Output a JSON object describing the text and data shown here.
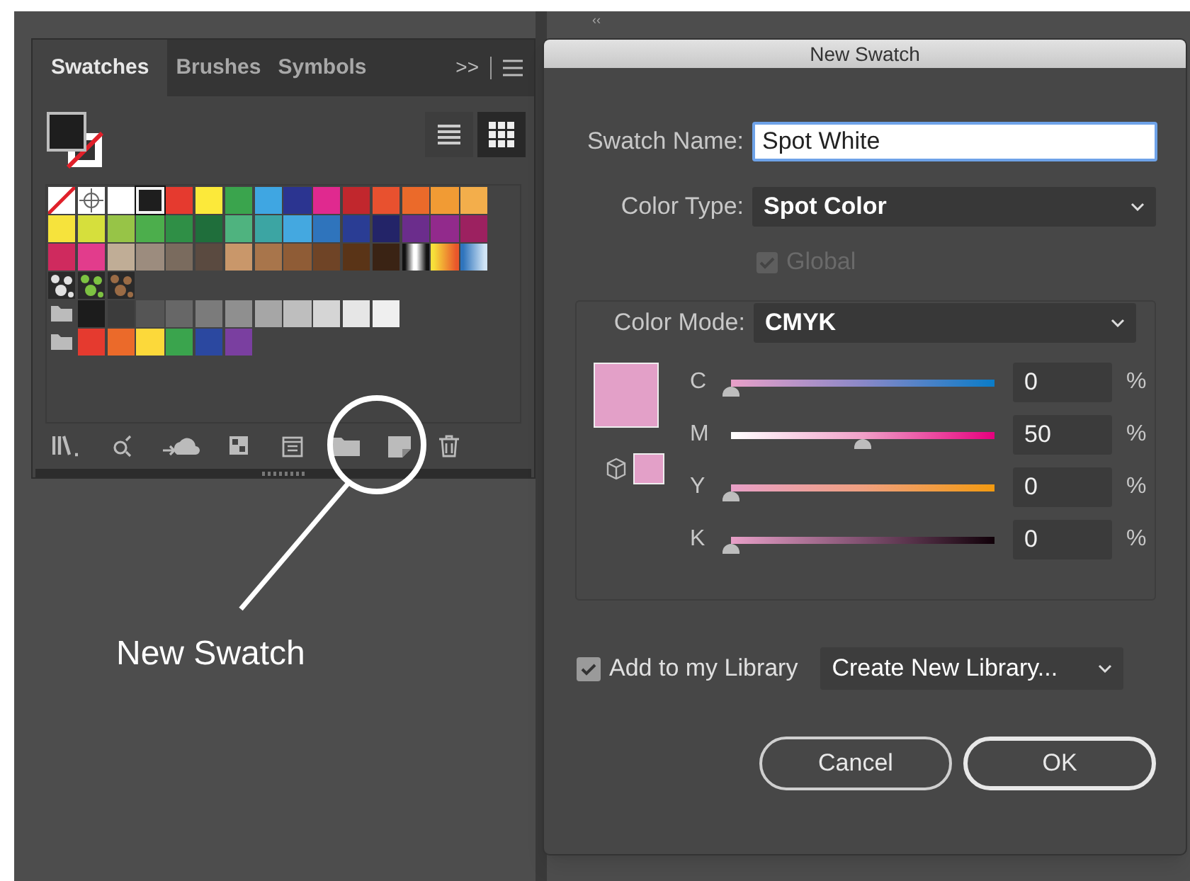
{
  "swatches_panel": {
    "tabs": [
      {
        "label": "Swatches",
        "selected": true
      },
      {
        "label": "Brushes",
        "selected": false
      },
      {
        "label": "Symbols",
        "selected": false
      }
    ],
    "overflow": ">>",
    "views": [
      {
        "kind": "list",
        "selected": false
      },
      {
        "kind": "grid",
        "selected": true
      }
    ],
    "rows": [
      {
        "items": [
          {
            "kind": "none",
            "selected": false
          },
          {
            "kind": "registration",
            "selected": false
          },
          {
            "kind": "color",
            "color": "#ffffff",
            "selected": false
          },
          {
            "kind": "color",
            "color": "#1e1e1e",
            "selected": true
          },
          {
            "kind": "color",
            "color": "#e53a2f",
            "selected": false
          },
          {
            "kind": "color",
            "color": "#fce93a",
            "selected": false
          },
          {
            "kind": "color",
            "color": "#3aa44d",
            "selected": false
          },
          {
            "kind": "color",
            "color": "#3fa6e2",
            "selected": false
          },
          {
            "kind": "color",
            "color": "#2b3490",
            "selected": false
          },
          {
            "kind": "color",
            "color": "#e0298f",
            "selected": false
          },
          {
            "kind": "color",
            "color": "#c1272d",
            "selected": false
          },
          {
            "kind": "color",
            "color": "#e8512f",
            "selected": false
          },
          {
            "kind": "color",
            "color": "#eb6a2a",
            "selected": false
          },
          {
            "kind": "color",
            "color": "#f19b34",
            "selected": false
          },
          {
            "kind": "color",
            "color": "#f3ae4b",
            "selected": false
          }
        ]
      },
      {
        "items": [
          {
            "kind": "color",
            "color": "#f6e33c",
            "selected": false
          },
          {
            "kind": "color",
            "color": "#d6df3c",
            "selected": false
          },
          {
            "kind": "color",
            "color": "#97c447",
            "selected": false
          },
          {
            "kind": "color",
            "color": "#4cae4c",
            "selected": false
          },
          {
            "kind": "color",
            "color": "#2f8f46",
            "selected": false
          },
          {
            "kind": "color",
            "color": "#1f6e3b",
            "selected": false
          },
          {
            "kind": "color",
            "color": "#4fb37f",
            "selected": false
          },
          {
            "kind": "color",
            "color": "#3ca5a3",
            "selected": false
          },
          {
            "kind": "color",
            "color": "#44a8e0",
            "selected": false
          },
          {
            "kind": "color",
            "color": "#2f74bc",
            "selected": false
          },
          {
            "kind": "color",
            "color": "#2a3d94",
            "selected": false
          },
          {
            "kind": "color",
            "color": "#232468",
            "selected": false
          },
          {
            "kind": "color",
            "color": "#6b2d8c",
            "selected": false
          },
          {
            "kind": "color",
            "color": "#922a8c",
            "selected": false
          },
          {
            "kind": "color",
            "color": "#9c2160",
            "selected": false
          }
        ]
      },
      {
        "items": [
          {
            "kind": "color",
            "color": "#cf2a5e",
            "selected": false
          },
          {
            "kind": "color",
            "color": "#e23c8c",
            "selected": false
          },
          {
            "kind": "color",
            "color": "#c0ad96",
            "selected": false
          },
          {
            "kind": "color",
            "color": "#9c8c7e",
            "selected": false
          },
          {
            "kind": "color",
            "color": "#7a6b5e",
            "selected": false
          },
          {
            "kind": "color",
            "color": "#5a4a40",
            "selected": false
          },
          {
            "kind": "color",
            "color": "#c9976a",
            "selected": false
          },
          {
            "kind": "color",
            "color": "#a8754b",
            "selected": false
          },
          {
            "kind": "color",
            "color": "#8f5c36",
            "selected": false
          },
          {
            "kind": "color",
            "color": "#6f4426",
            "selected": false
          },
          {
            "kind": "color",
            "color": "#5a3417",
            "selected": false
          },
          {
            "kind": "color",
            "color": "#3a2314",
            "selected": false
          },
          {
            "kind": "gradient",
            "stops": [
              {
                "color": "#111111"
              },
              {
                "color": "#ffffff"
              },
              {
                "color": "#111111"
              }
            ],
            "selected": false
          },
          {
            "kind": "gradient",
            "stops": [
              {
                "color": "#f7e03a"
              },
              {
                "color": "#e9572b"
              }
            ],
            "selected": false
          },
          {
            "kind": "gradient",
            "stops": [
              {
                "color": "#2f74bc"
              },
              {
                "color": "#d0e4f5"
              }
            ],
            "selected": false
          }
        ]
      },
      {
        "items": [
          {
            "kind": "pattern",
            "color": "#e0e0e0",
            "selected": false
          },
          {
            "kind": "pattern",
            "color": "#7dc242",
            "selected": false
          },
          {
            "kind": "pattern",
            "color": "#9a6b45",
            "selected": false
          }
        ]
      },
      {
        "items": [
          {
            "kind": "folder",
            "selected": false
          },
          {
            "kind": "color",
            "color": "#1c1c1c",
            "selected": false
          },
          {
            "kind": "color",
            "color": "#3c3c3c",
            "selected": false
          },
          {
            "kind": "color",
            "color": "#555555",
            "selected": false
          },
          {
            "kind": "color",
            "color": "#676767",
            "selected": false
          },
          {
            "kind": "color",
            "color": "#7b7b7b",
            "selected": false
          },
          {
            "kind": "color",
            "color": "#8f8f8f",
            "selected": false
          },
          {
            "kind": "color",
            "color": "#a6a6a6",
            "selected": false
          },
          {
            "kind": "color",
            "color": "#bebebe",
            "selected": false
          },
          {
            "kind": "color",
            "color": "#d5d5d5",
            "selected": false
          },
          {
            "kind": "color",
            "color": "#e6e6e6",
            "selected": false
          },
          {
            "kind": "color",
            "color": "#efefef",
            "selected": false
          }
        ]
      },
      {
        "items": [
          {
            "kind": "folder",
            "selected": false
          },
          {
            "kind": "color",
            "color": "#e53a2f",
            "selected": false
          },
          {
            "kind": "color",
            "color": "#eb6a2a",
            "selected": false
          },
          {
            "kind": "color",
            "color": "#fcd93a",
            "selected": false
          },
          {
            "kind": "color",
            "color": "#3aa44d",
            "selected": false
          },
          {
            "kind": "color",
            "color": "#2b48a0",
            "selected": false
          },
          {
            "kind": "color",
            "color": "#7a3fa0",
            "selected": false
          }
        ]
      }
    ]
  },
  "dialog": {
    "title": "New Swatch",
    "swatch_name": {
      "label": "Swatch Name:",
      "value": "Spot White"
    },
    "color_type": {
      "label": "Color Type:",
      "value": "Spot Color"
    },
    "global": {
      "label": "Global",
      "checked": true,
      "disabled": true
    },
    "color_mode": {
      "label": "Color Mode:",
      "value": "CMYK"
    },
    "preview": {
      "color": "#e3a0c8"
    },
    "channels": [
      {
        "label": "C",
        "level": 0,
        "value": "0",
        "unit": "%"
      },
      {
        "label": "M",
        "level": 0.5,
        "value": "50",
        "unit": "%"
      },
      {
        "label": "Y",
        "level": 0,
        "value": "0",
        "unit": "%"
      },
      {
        "label": "K",
        "level": 0,
        "value": "0",
        "unit": "%"
      }
    ],
    "add_to_library": {
      "label": "Add to my Library",
      "checked": true
    },
    "library": {
      "value": "Create New Library..."
    },
    "buttons": [
      {
        "label": "Cancel",
        "default": false
      },
      {
        "label": "OK",
        "default": true
      }
    ]
  },
  "annotation": {
    "label": "New Swatch"
  },
  "collapse_glyph": "‹‹"
}
